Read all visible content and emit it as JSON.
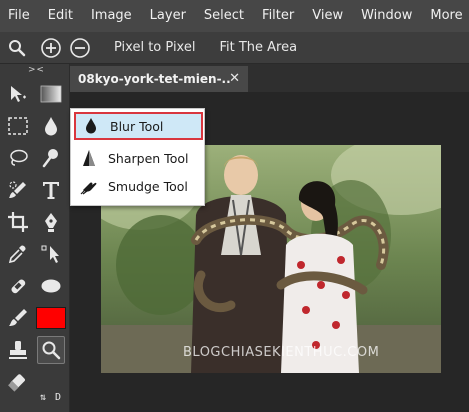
{
  "menubar": {
    "items": [
      "File",
      "Edit",
      "Image",
      "Layer",
      "Select",
      "Filter",
      "View",
      "Window",
      "More"
    ]
  },
  "options_bar": {
    "pixel_to_pixel": "Pixel to Pixel",
    "fit_the_area": "Fit The Area",
    "icons": [
      "zoom-icon",
      "zoom-in-icon",
      "zoom-out-icon"
    ]
  },
  "toolbar": {
    "collapse": "> <",
    "tools": [
      "move",
      "gradient",
      "marquee",
      "blur-drop",
      "lasso",
      "brush",
      "quick-select",
      "type",
      "crop",
      "pen",
      "eyedropper",
      "path-select",
      "healing",
      "shape-ellipse",
      "brush-2",
      "hand",
      "clone-stamp",
      "zoom",
      "eraser"
    ],
    "foreground_color": "#ff0000",
    "swap_label": "⇅",
    "default_label": "D"
  },
  "document_tab": {
    "title": "08kyo-york-tet-mien-..",
    "close": "✕"
  },
  "flyout": {
    "items": [
      {
        "label": "Blur Tool",
        "icon": "blur-drop-icon",
        "selected": true
      },
      {
        "label": "Sharpen Tool",
        "icon": "sharpen-triangle-icon",
        "selected": false
      },
      {
        "label": "Smudge Tool",
        "icon": "smudge-hand-icon",
        "selected": false
      }
    ],
    "highlight_color": "#d9363e",
    "selected_bg": "#cfe8f7"
  },
  "canvas": {
    "watermark": "BLOGCHIASEKIENTHUC.COM"
  }
}
